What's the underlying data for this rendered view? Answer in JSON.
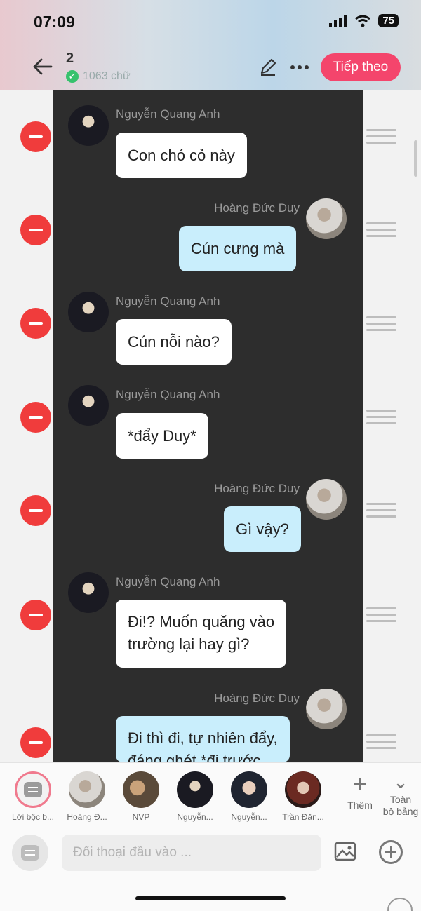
{
  "status_bar": {
    "time": "07:09",
    "battery": "75"
  },
  "header": {
    "count": "2",
    "sub_count": "1063 chữ",
    "next_label": "Tiếp theo",
    "back_icon": "arrow-left-icon",
    "edit_icon": "pencil-icon",
    "more_icon": "more-dots-icon"
  },
  "messages": [
    {
      "sender": "Nguyễn Quang Anh",
      "text": "Con chó cỏ này",
      "side": "left"
    },
    {
      "sender": "Hoàng Đức Duy",
      "text": "Cún cưng mà",
      "side": "right"
    },
    {
      "sender": "Nguyễn Quang Anh",
      "text": "Cún nỗi nào?",
      "side": "left"
    },
    {
      "sender": "Nguyễn Quang Anh",
      "text": "*đẩy Duy*",
      "side": "left"
    },
    {
      "sender": "Hoàng Đức Duy",
      "text": "Gì vậy?",
      "side": "right"
    },
    {
      "sender": "Nguyễn Quang Anh",
      "text": "Đi!? Muốn quăng vào\ntrường lại hay gì?",
      "side": "left"
    },
    {
      "sender": "Hoàng Đức Duy",
      "text": "Đi thì đi, tự nhiên đẩy,\nđáng ghét *đi trước",
      "side": "right"
    }
  ],
  "characters": [
    {
      "label": "Lời bộc b..."
    },
    {
      "label": "Hoàng Đ..."
    },
    {
      "label": "NVP"
    },
    {
      "label": "Nguyễn..."
    },
    {
      "label": "Nguyễn..."
    },
    {
      "label": "Trần Đăn..."
    }
  ],
  "char_actions": {
    "add_label": "Thêm",
    "all_label": "Toàn\nbộ bảng"
  },
  "input": {
    "placeholder": "Đối thoại đầu vào ..."
  },
  "colors": {
    "accent": "#f4456c",
    "delete": "#f03c3c",
    "bubble_blue": "#c9eefc",
    "chat_bg": "#2d2d2d"
  }
}
